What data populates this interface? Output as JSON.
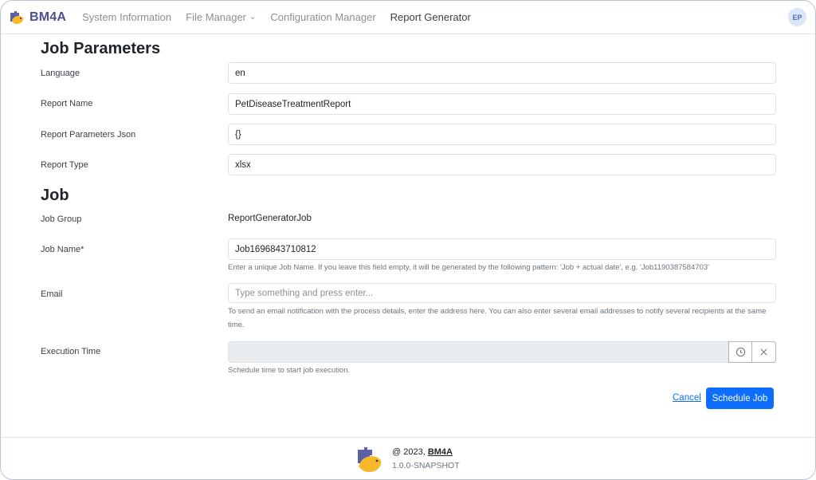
{
  "navbar": {
    "brand": "BM4A",
    "items": [
      {
        "label": "System Information",
        "active": false,
        "dropdown": false
      },
      {
        "label": "File Manager",
        "active": false,
        "dropdown": true
      },
      {
        "label": "Configuration Manager",
        "active": false,
        "dropdown": false
      },
      {
        "label": "Report Generator",
        "active": true,
        "dropdown": false
      }
    ],
    "avatar_initials": "EP"
  },
  "job_parameters": {
    "heading": "Job Parameters",
    "fields": [
      {
        "label": "Language",
        "value": "en"
      },
      {
        "label": "Report Name",
        "value": "PetDiseaseTreatmentReport"
      },
      {
        "label": "Report Parameters Json",
        "value": "{}"
      },
      {
        "label": "Report Type",
        "value": "xlsx"
      }
    ]
  },
  "job": {
    "heading": "Job",
    "job_group": {
      "label": "Job Group",
      "value": "ReportGeneratorJob"
    },
    "job_name": {
      "label": "Job Name*",
      "value": "Job1696843710812",
      "help": "Enter a unique Job Name. If you leave this field empty, it will be generated by the following pattern: 'Job + actual date', e.g. 'Job1190387584703'"
    },
    "email": {
      "label": "Email",
      "placeholder": "Type something and press enter...",
      "help": "To send an email notification with the process details, enter the address here. You can also enter several email addresses to notify several recipients at the same time."
    },
    "execution_time": {
      "label": "Execution Time",
      "value": "",
      "help": "Schedule time to start job execution.",
      "icons": [
        "clock-icon",
        "close-icon"
      ]
    }
  },
  "actions": {
    "cancel_label": "Cancel",
    "schedule_label": "Schedule Job"
  },
  "footer": {
    "copyright_prefix": "@ 2023, ",
    "copyright_link": "BM4A",
    "version": "1.0.0-SNAPSHOT"
  },
  "colors": {
    "primary": "#0d6efd",
    "brand": "#4a4f8f",
    "logo_puzzle": "#5b5fa8",
    "logo_bird": "#f7b82a"
  }
}
